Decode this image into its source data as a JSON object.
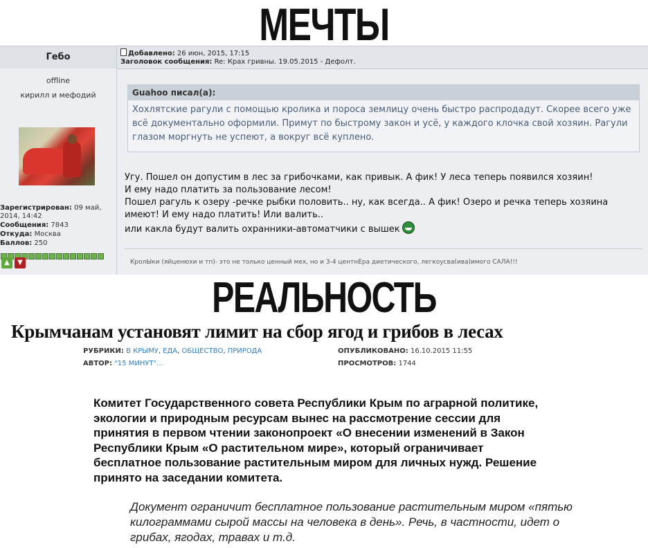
{
  "captions": {
    "top": "МЕЧТЫ",
    "bottom": "РЕАЛЬНОСТЬ"
  },
  "forum": {
    "author_name": "Гебо",
    "post_header": {
      "posted_label": "Добавлено:",
      "posted_value": "26 июн, 2015, 17:15",
      "subject_label": "Заголовок сообщения:",
      "subject_value": "Re: Крах гривны. 19.05.2015 - Дефолт."
    },
    "status": "offline",
    "user_title": "кирилл и мефодий",
    "stats": {
      "registered_label": "Зарегистрирован:",
      "registered_value": "09 май, 2014, 14:42",
      "messages_label": "Сообщения:",
      "messages_value": "7843",
      "from_label": "Откуда:",
      "from_value": "Москва",
      "points_label": "Баллов:",
      "points_value": "250"
    },
    "rating_bars": 15,
    "quote": {
      "author": "Guahoo писал(а):",
      "text": "Хохлятские рагули с помощью кролика и пороса землицу очень быстро распродадут. Скорее всего уже всё документально оформили. Примут по быстрому закон и усё, у каждого клочка свой хозяин. Рагули глазом моргнуть не успеют, а вокруг всё куплено."
    },
    "body": [
      "Угу. Пошел он допустим в лес за грибочками, как привык. А фик! У леса теперь появился хозяин!",
      "И ему надо платить за пользование лесом!",
      "Пошел рагуль к озеру -речке рыбки половить.. ну, как всегда.. А фик! Озеро и речка теперь хозяина имеют! И ему надо платить! Или валить..",
      "или какла будут валить охранники-автоматчики с вышек"
    ],
    "signature": "КролЫки (яйценюхи и тп)- это не только ценный мех, но и 3-4 центнЕра диетического, легкоусва(ива)имого САЛА!!!",
    "colors": {
      "panel": "#eceef1",
      "quote_text": "#4a5c75",
      "rating_green": "#6bb34a"
    }
  },
  "news": {
    "headline": "Крымчанам установят лимит на сбор ягод и грибов в лесах",
    "rubrics_label": "РУБРИКИ:",
    "rubrics": [
      "В КРЫМУ",
      "ЕДА",
      "ОБЩЕСТВО",
      "ПРИРОДА"
    ],
    "author_label": "АВТОР:",
    "author_value": "\"15 МИНУТ\"...",
    "published_label": "ОПУБЛИКОВАНО:",
    "published_value": "16.10.2015 11:55",
    "views_label": "ПРОСМОТРОВ:",
    "views_value": "1744",
    "lead": "Комитет Государственного совета Республики Крым по аграрной политике, экологии и природным ресурсам вынес на рассмотрение сессии для принятия в первом чтении законопроект «О внесении изменений в Закон Республики Крым «О растительном мире», который ограничивает бесплатное пользование растительным миром для личных нужд. Решение принято на заседании комитета.",
    "quote": "Документ ограничит бесплатное пользование растительным миром «пятью килограммами сырой массы на человека в день». Речь, в частности, идет о грибах, ягодах, травах и т.д.",
    "colors": {
      "link": "#2f7fc8"
    }
  }
}
